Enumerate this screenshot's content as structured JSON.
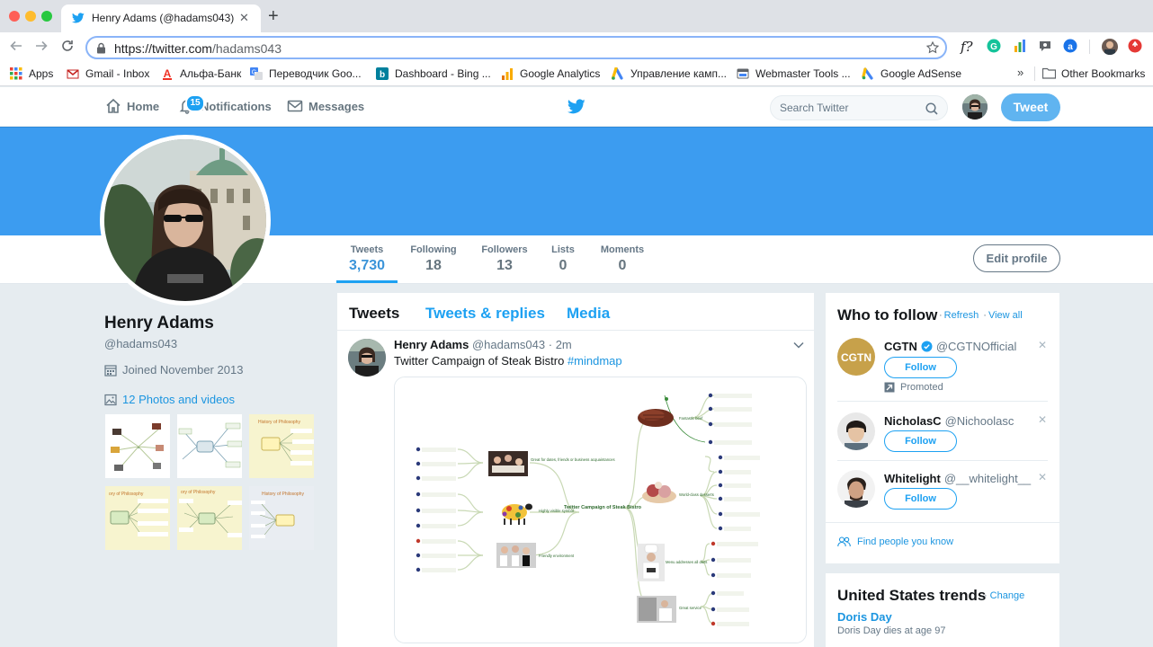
{
  "browser": {
    "tab_title": "Henry Adams (@hadams043) | Twitter",
    "url_host": "https://twitter.com",
    "url_path": "/hadams043",
    "extensions": [
      "f?",
      "grammarly-icon",
      "analytics-icon",
      "chat-icon",
      "a-icon",
      "avatar-icon",
      "stop-icon"
    ]
  },
  "bookmarks": {
    "items": [
      {
        "label": "Apps",
        "icon": "apps-grid-icon"
      },
      {
        "label": "Gmail - Inbox",
        "icon": "gmail-icon"
      },
      {
        "label": "Альфа-Банк",
        "icon": "alfa-bank-icon"
      },
      {
        "label": "Переводчик Goo...",
        "icon": "translate-icon"
      },
      {
        "label": "Dashboard - Bing ...",
        "icon": "bing-icon"
      },
      {
        "label": "Google Analytics",
        "icon": "analytics-icon"
      },
      {
        "label": "Управление камп...",
        "icon": "google-ads-icon"
      },
      {
        "label": "Webmaster Tools ...",
        "icon": "webmaster-icon"
      },
      {
        "label": "Google AdSense",
        "icon": "adsense-icon"
      }
    ],
    "overflow": "»",
    "other": "Other Bookmarks"
  },
  "nav": {
    "home": "Home",
    "notifications": "Notifications",
    "notifications_count": "15",
    "messages": "Messages",
    "search_placeholder": "Search Twitter",
    "tweet_button": "Tweet"
  },
  "profile": {
    "name": "Henry Adams",
    "handle": "@hadams043",
    "joined": "Joined November 2013",
    "photos": "12 Photos and videos",
    "edit_profile": "Edit profile",
    "stats": [
      {
        "label": "Tweets",
        "value": "3,730"
      },
      {
        "label": "Following",
        "value": "18"
      },
      {
        "label": "Followers",
        "value": "13"
      },
      {
        "label": "Lists",
        "value": "0"
      },
      {
        "label": "Moments",
        "value": "0"
      }
    ]
  },
  "timeline": {
    "tabs": [
      "Tweets",
      "Tweets & replies",
      "Media"
    ],
    "tweet": {
      "name": "Henry Adams",
      "handle": "@hadams043",
      "time": "2m",
      "text": "Twitter Campaign of Steak Bistro",
      "hashtag": "#mindmap"
    },
    "mindmap": {
      "center": "Twitter Campaign of Steak Bistro",
      "branches": [
        "Great for dates, friends or business acquaintances",
        "Highly visible symbol",
        "Friendly environment",
        "Fantastic beef",
        "World-class desserts",
        "Menu addresses all diets",
        "Great service"
      ]
    }
  },
  "who_to_follow": {
    "title": "Who to follow",
    "refresh": "Refresh",
    "view_all": "View all",
    "follow_label": "Follow",
    "promoted": "Promoted",
    "accounts": [
      {
        "name": "CGTN",
        "handle": "@CGTNOfficial",
        "verified": true
      },
      {
        "name": "NicholasC",
        "handle": "@Nichoolasc",
        "verified": false
      },
      {
        "name": "Whitelight",
        "handle": "@__whitelight__",
        "verified": false
      }
    ],
    "find_people": "Find people you know"
  },
  "trends": {
    "title": "United States trends",
    "change": "Change",
    "items": [
      {
        "name": "Doris Day",
        "desc": "Doris Day dies at age 97"
      }
    ]
  }
}
